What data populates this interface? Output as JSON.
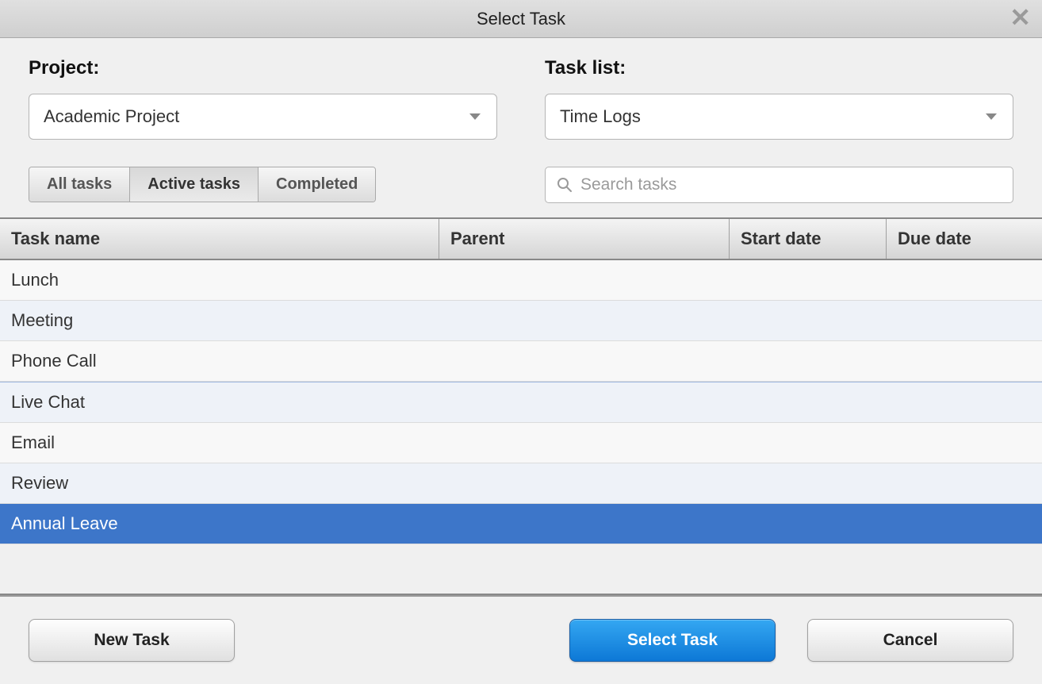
{
  "title": "Select Task",
  "project": {
    "label": "Project:",
    "value": "Academic Project"
  },
  "tasklist": {
    "label": "Task list:",
    "value": "Time Logs"
  },
  "filters": {
    "all": "All tasks",
    "active": "Active tasks",
    "completed": "Completed",
    "activeIndex": 1
  },
  "search": {
    "placeholder": "Search tasks",
    "value": ""
  },
  "columns": {
    "name": "Task name",
    "parent": "Parent",
    "start": "Start date",
    "due": "Due date"
  },
  "rows": [
    {
      "name": "Lunch",
      "parent": "",
      "start": "",
      "due": "",
      "selected": false
    },
    {
      "name": "Meeting",
      "parent": "",
      "start": "",
      "due": "",
      "selected": false
    },
    {
      "name": "Phone Call",
      "parent": "",
      "start": "",
      "due": "",
      "selected": false
    },
    {
      "name": "Live Chat",
      "parent": "",
      "start": "",
      "due": "",
      "selected": false
    },
    {
      "name": "Email",
      "parent": "",
      "start": "",
      "due": "",
      "selected": false
    },
    {
      "name": "Review",
      "parent": "",
      "start": "",
      "due": "",
      "selected": false
    },
    {
      "name": "Annual Leave",
      "parent": "",
      "start": "",
      "due": "",
      "selected": true
    }
  ],
  "buttons": {
    "new_task": "New Task",
    "select_task": "Select Task",
    "cancel": "Cancel"
  }
}
